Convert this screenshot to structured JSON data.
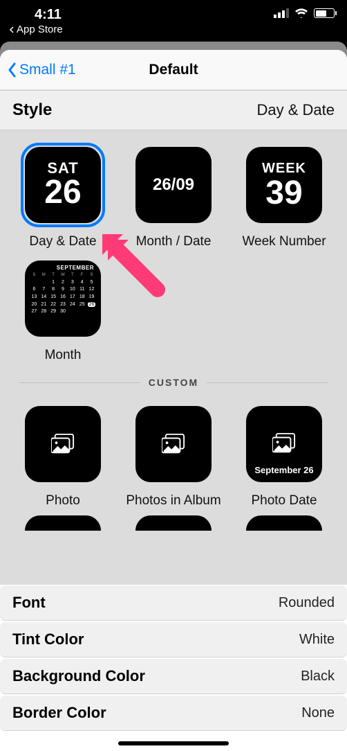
{
  "status": {
    "time": "4:11",
    "back": "App Store"
  },
  "nav": {
    "back": "Small #1",
    "title": "Default"
  },
  "style_row": {
    "label": "Style",
    "value": "Day & Date"
  },
  "tiles": {
    "daydate": {
      "top": "SAT",
      "big": "26",
      "caption": "Day & Date"
    },
    "monthdate": {
      "text": "26/09",
      "caption": "Month / Date"
    },
    "weeknum": {
      "top": "WEEK",
      "big": "39",
      "caption": "Week Number"
    },
    "month": {
      "header": "SEPTEMBER",
      "caption": "Month"
    }
  },
  "divider": "CUSTOM",
  "custom": {
    "photo": {
      "caption": "Photo"
    },
    "album": {
      "caption": "Photos in Album"
    },
    "photodate": {
      "text": "September 26",
      "caption": "Photo Date"
    }
  },
  "settings": {
    "font": {
      "label": "Font",
      "value": "Rounded"
    },
    "tint": {
      "label": "Tint Color",
      "value": "White"
    },
    "bg": {
      "label": "Background Color",
      "value": "Black"
    },
    "border": {
      "label": "Border Color",
      "value": "None"
    }
  }
}
